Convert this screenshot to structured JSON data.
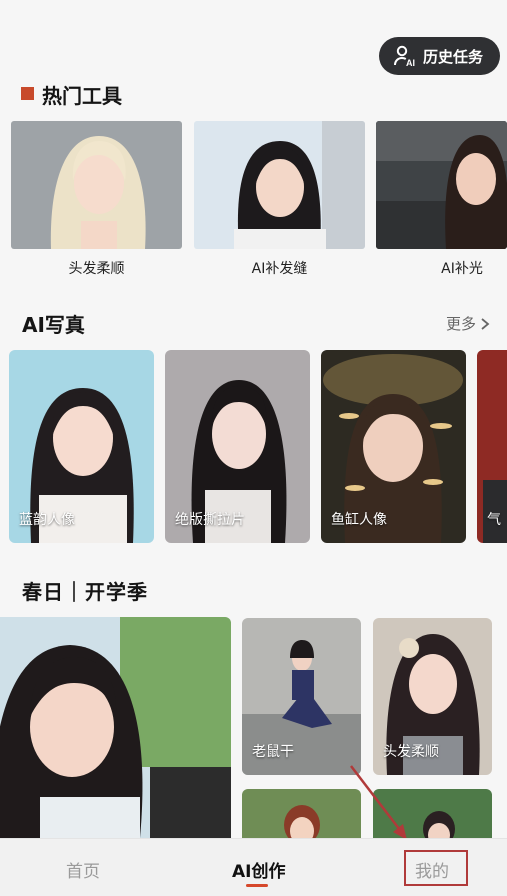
{
  "header": {
    "history_label": "历史任务",
    "history_icon": "user-ai-icon"
  },
  "hot_tools": {
    "title": "热门工具",
    "items": [
      {
        "label": "头发柔顺"
      },
      {
        "label": "AI补发缝"
      },
      {
        "label": "AI补光"
      }
    ]
  },
  "ai_photo": {
    "title": "AI写真",
    "more_label": "更多",
    "items": [
      {
        "label": "蓝韵人像"
      },
      {
        "label": "绝版撕拉片"
      },
      {
        "label": "鱼缸人像"
      },
      {
        "label": "气"
      }
    ]
  },
  "spring": {
    "title": "春日｜开学季",
    "items": [
      {
        "label": "老鼠干"
      },
      {
        "label": "头发柔顺"
      }
    ]
  },
  "bottom_nav": {
    "home": "首页",
    "ai_create": "AI创作",
    "mine": "我的"
  },
  "colors": {
    "accent": "#d6482b",
    "marker": "#c84a2b",
    "annotation": "#b03a3a"
  }
}
